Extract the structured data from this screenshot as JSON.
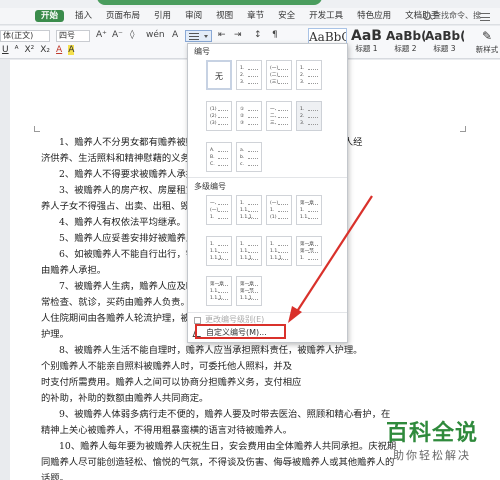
{
  "menubar": {
    "tabs": [
      "开始",
      "插入",
      "页面布局",
      "引用",
      "审阅",
      "视图",
      "章节",
      "安全",
      "开发工具",
      "特色应用",
      "文档助手"
    ],
    "search_label": "查找命令、搜"
  },
  "ribbon": {
    "font_name": "体(正文)",
    "font_size": "四号",
    "row2_items": [
      "U",
      "A",
      "X²",
      "X₂",
      "A",
      "A"
    ],
    "styles": [
      {
        "preview": "AaBbC",
        "label": "正文"
      },
      {
        "preview": "AaB",
        "label": "标题 1"
      },
      {
        "preview": "AaBb(",
        "label": "标题 2"
      },
      {
        "preview": "AaBb(",
        "label": "标题 3"
      }
    ],
    "new_style_label": "新样式"
  },
  "dropdown": {
    "section1_title": "编号",
    "none_label": "无",
    "section2_title": "多级编号",
    "link_disabled": "更改编号级别(E)",
    "link_custom": "自定义编号(M)..."
  },
  "document": {
    "paragraphs": [
      "1、赡养人不分男女都有赡养被赡养人的义务。赡养人应当履行对老年人经",
      "济供养、生活照料和精神慰藉的义务。",
      "2、赡养人不得要求被赡养人承担力不能及的劳动。",
      "3、被赡养人的房产权、房屋租赁权受法律保护，赡养人不得侵占。赡",
      "养人子女不得强占、出卖、出租、毁坏房屋。",
      "4、赡养人有权依法平均继承。",
      "5、赡养人应妥善安排好被赡养人的住房。",
      "6、如被赡养人不能自行出行，需交通费",
      "由赡养人承担。",
      "7、被赡养人生病，赡养人应及时送医，被赡养人日",
      "常检查、就诊，买药由赡养人负责。被赡养",
      "人住院期间由各赡养人轮流护理，被赡养人可聘请专人",
      "护理。",
      "8、被赡养人生活不能自理时，赡养人应当承担照料责任，被赡养人护理。",
      "个别赡养人不能亲自照料被赡养人时，可委托他人照料，并及",
      "时支付所需费用。赡养人之间可以协商分担赡养义务，支付相应",
      "的补助，补助的数额由赡养人共同商定。",
      "9、被赡养人体弱多病行走不便的，赡养人要及时带去医治、照顾和精心看护，在",
      "精神上关心被赡养人，不得用粗暴蛮横的语言对待被赡养人。",
      "10、赡养人每年要为被赡养人庆祝生日，安会费用由全体赡养人共同承担。庆祝期",
      "同赡养人尽可能创造轻松、愉悦的气氛，不得谈及伤害、侮辱被赡养人或其他赡养人的",
      "话题。"
    ]
  },
  "watermark": {
    "big": "百科全说",
    "small": "助你轻松解决"
  },
  "colors": {
    "accent_green": "#3b8c4c",
    "annotation_red": "#d9312b"
  }
}
